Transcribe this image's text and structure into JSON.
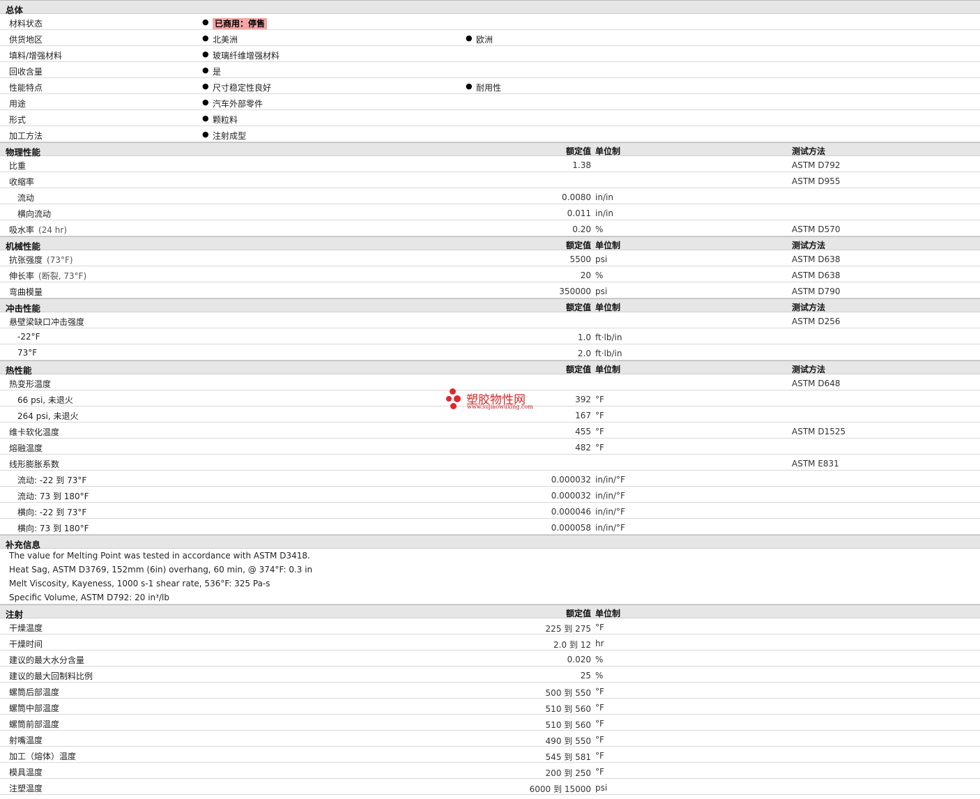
{
  "general": {
    "title": "总体",
    "rows": [
      {
        "label": "材料状态",
        "items": [
          "已商用：停售"
        ],
        "highlight": true
      },
      {
        "label": "供货地区",
        "items": [
          "北美洲",
          "欧洲"
        ]
      },
      {
        "label": "填料/增强材料",
        "items": [
          "玻璃纤维增强材料"
        ]
      },
      {
        "label": "回收含量",
        "items": [
          "是"
        ]
      },
      {
        "label": "性能特点",
        "items": [
          "尺寸稳定性良好",
          "耐用性"
        ]
      },
      {
        "label": "用途",
        "items": [
          "汽车外部零件"
        ]
      },
      {
        "label": "形式",
        "items": [
          "颗粒料"
        ]
      },
      {
        "label": "加工方法",
        "items": [
          "注射成型"
        ]
      }
    ]
  },
  "headers": {
    "value": "额定值",
    "unit": "单位制",
    "method": "测试方法"
  },
  "sections": [
    {
      "title": "物理性能",
      "show_method": true,
      "rows": [
        {
          "label": "比重",
          "value": "1.38",
          "unit": "",
          "method": "ASTM D792"
        },
        {
          "label": "收缩率",
          "value": "",
          "unit": "",
          "method": "ASTM D955"
        },
        {
          "label": "流动",
          "sub": true,
          "value": "0.0080",
          "unit": "in/in",
          "method": ""
        },
        {
          "label": "横向流动",
          "sub": true,
          "value": "0.011",
          "unit": "in/in",
          "method": ""
        },
        {
          "label": "吸水率",
          "cond": "(24 hr)",
          "value": "0.20",
          "unit": "%",
          "method": "ASTM D570"
        }
      ]
    },
    {
      "title": "机械性能",
      "show_method": true,
      "rows": [
        {
          "label": "抗张强度",
          "cond": "(73°F)",
          "value": "5500",
          "unit": "psi",
          "method": "ASTM D638"
        },
        {
          "label": "伸长率",
          "cond": "(断裂, 73°F)",
          "value": "20",
          "unit": "%",
          "method": "ASTM D638"
        },
        {
          "label": "弯曲模量",
          "value": "350000",
          "unit": "psi",
          "method": "ASTM D790"
        }
      ]
    },
    {
      "title": "冲击性能",
      "show_method": true,
      "rows": [
        {
          "label": "悬壁梁缺口冲击强度",
          "value": "",
          "unit": "",
          "method": "ASTM D256"
        },
        {
          "label": "-22°F",
          "sub": true,
          "value": "1.0",
          "unit": "ft·lb/in",
          "method": ""
        },
        {
          "label": "73°F",
          "sub": true,
          "value": "2.0",
          "unit": "ft·lb/in",
          "method": ""
        }
      ]
    },
    {
      "title": "热性能",
      "show_method": true,
      "rows": [
        {
          "label": "热变形温度",
          "value": "",
          "unit": "",
          "method": "ASTM D648"
        },
        {
          "label": "66 psi, 未退火",
          "sub": true,
          "value": "392",
          "unit": "°F",
          "method": ""
        },
        {
          "label": "264 psi, 未退火",
          "sub": true,
          "value": "167",
          "unit": "°F",
          "method": ""
        },
        {
          "label": "维卡软化温度",
          "value": "455",
          "unit": "°F",
          "method": "ASTM D1525"
        },
        {
          "label": "熔融温度",
          "value": "482",
          "unit": "°F",
          "method": ""
        },
        {
          "label": "线形膨胀系数",
          "value": "",
          "unit": "",
          "method": "ASTM E831"
        },
        {
          "label": "流动: -22 到  73°F",
          "sub": true,
          "value": "0.000032",
          "unit": "in/in/°F",
          "method": ""
        },
        {
          "label": "流动: 73 到  180°F",
          "sub": true,
          "value": "0.000032",
          "unit": "in/in/°F",
          "method": ""
        },
        {
          "label": "横向: -22 到  73°F",
          "sub": true,
          "value": "0.000046",
          "unit": "in/in/°F",
          "method": ""
        },
        {
          "label": "横向: 73 到  180°F",
          "sub": true,
          "value": "0.000058",
          "unit": "in/in/°F",
          "method": ""
        }
      ]
    }
  ],
  "notes": {
    "title": "补充信息",
    "lines": [
      "The value for Melting Point was tested in accordance with ASTM D3418.",
      "Heat Sag, ASTM D3769, 152mm (6in) overhang, 60 min, @ 374°F: 0.3 in",
      "Melt Viscosity, Kayeness, 1000 s-1 shear rate, 536°F: 325 Pa-s",
      "Specific Volume, ASTM D792: 20 in³/lb"
    ]
  },
  "injection": {
    "title": "注射",
    "show_method": false,
    "rows": [
      {
        "label": "干燥温度",
        "value": "225 到  275",
        "unit": "°F"
      },
      {
        "label": "干燥时间",
        "value": "2.0 到  12",
        "unit": "hr"
      },
      {
        "label": "建议的最大水分含量",
        "value": "0.020",
        "unit": "%"
      },
      {
        "label": "建议的最大回制料比例",
        "value": "25",
        "unit": "%"
      },
      {
        "label": "螺筒后部温度",
        "value": "500 到  550",
        "unit": "°F"
      },
      {
        "label": "螺筒中部温度",
        "value": "510 到  560",
        "unit": "°F"
      },
      {
        "label": "螺筒前部温度",
        "value": "510 到  560",
        "unit": "°F"
      },
      {
        "label": "射嘴温度",
        "value": "490 到  550",
        "unit": "°F"
      },
      {
        "label": "加工（熔体）温度",
        "value": "545 到  581",
        "unit": "°F"
      },
      {
        "label": "模具温度",
        "value": "200 到  250",
        "unit": "°F"
      },
      {
        "label": "注塑温度",
        "value": "6000 到  15000",
        "unit": "psi"
      }
    ]
  },
  "watermark": {
    "name": "塑胶物性网",
    "url": "www.sujiaowuxing.com",
    "color": "#e0262e"
  }
}
